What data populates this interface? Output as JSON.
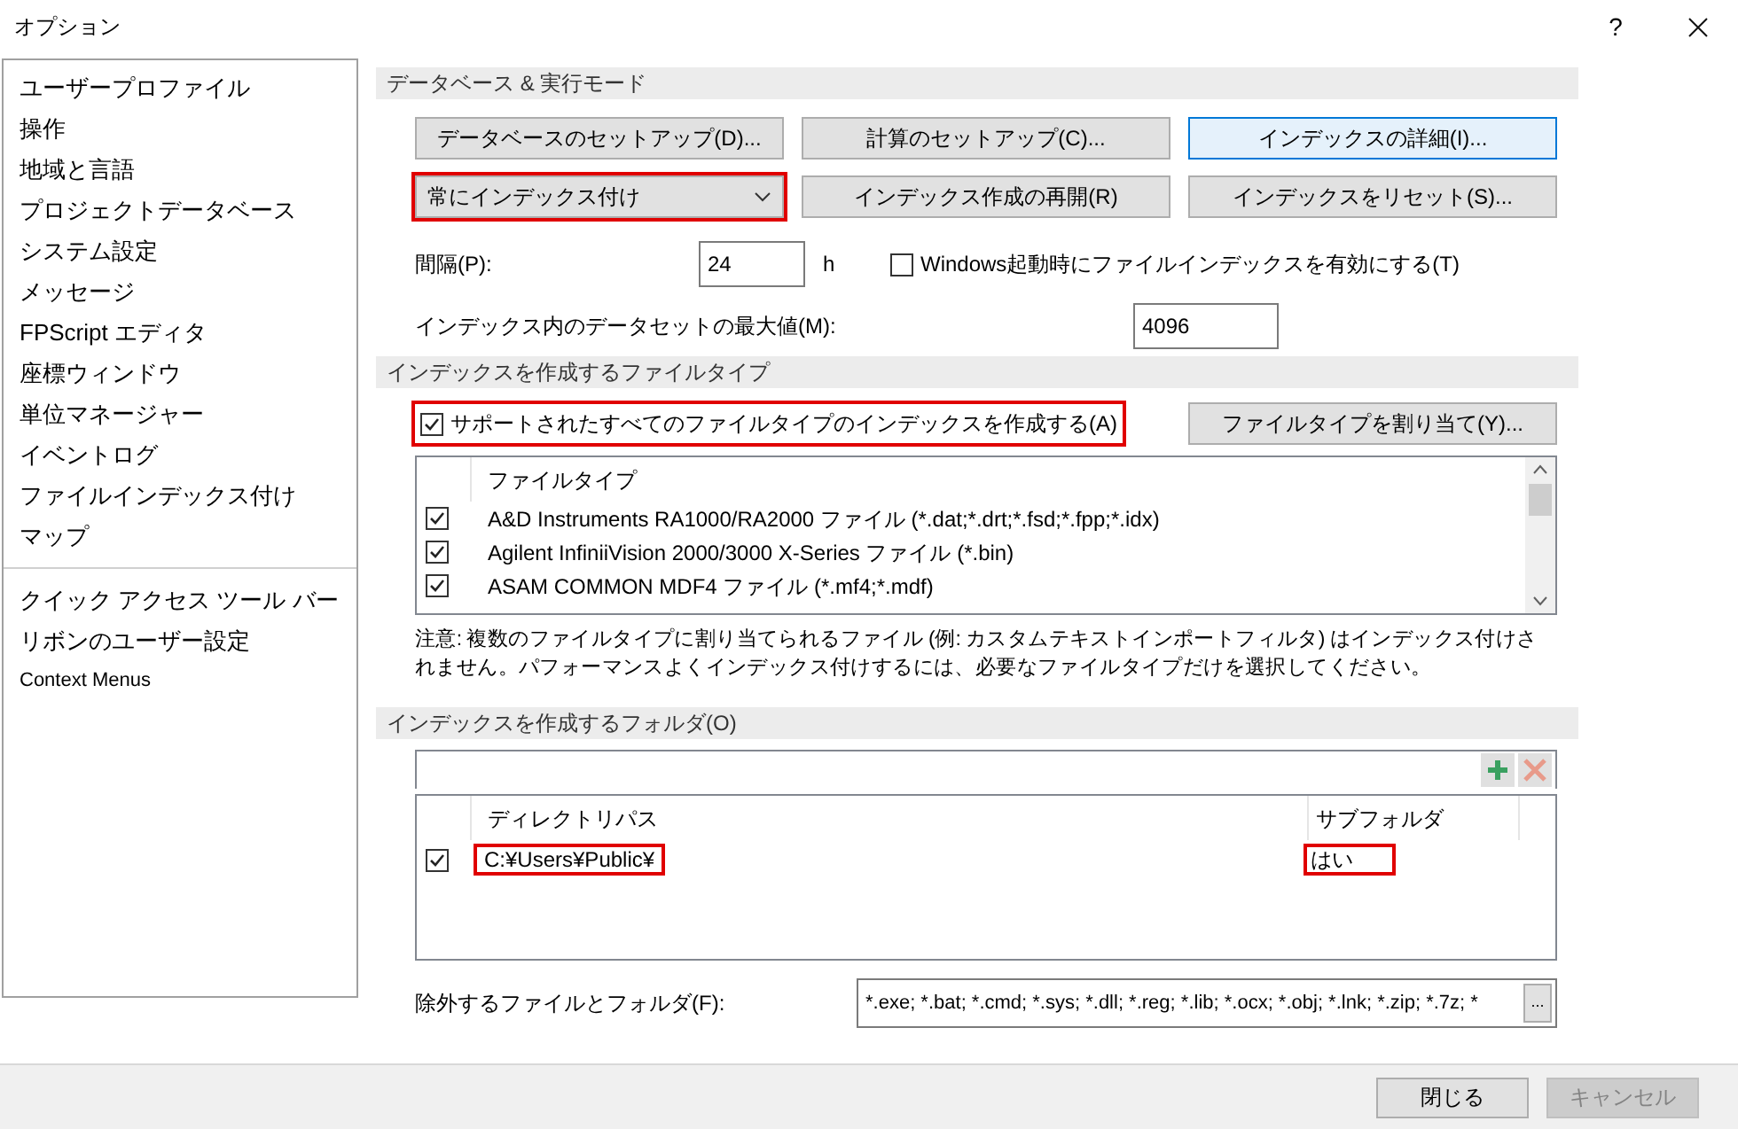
{
  "window": {
    "title": "オプション",
    "help": "?"
  },
  "sidebar": {
    "groups": [
      [
        {
          "label": "ユーザープロファイル",
          "selected": false
        },
        {
          "label": "操作",
          "selected": false
        },
        {
          "label": "地域と言語",
          "selected": false
        },
        {
          "label": "プロジェクトデータベース",
          "selected": false
        },
        {
          "label": "システム設定",
          "selected": false
        },
        {
          "label": "メッセージ",
          "selected": false
        },
        {
          "label": "FPScript エディタ",
          "selected": false
        },
        {
          "label": "座標ウィンドウ",
          "selected": false
        },
        {
          "label": "単位マネージャー",
          "selected": false
        },
        {
          "label": "イベントログ",
          "selected": false
        },
        {
          "label": "ファイルインデックス付け",
          "selected": false
        },
        {
          "label": "マップ",
          "selected": false
        }
      ],
      [
        {
          "label": "クイック アクセス ツール バー",
          "selected": false
        },
        {
          "label": "リボンのユーザー設定",
          "selected": false
        },
        {
          "label": "Context Menus",
          "selected": false
        }
      ]
    ]
  },
  "database_section": {
    "title": "データベース & 実行モード",
    "buttons": [
      {
        "label": "データベースのセットアップ(D)...",
        "focused": false
      },
      {
        "label": "計算のセットアップ(C)...",
        "focused": false
      },
      {
        "label": "インデックスの詳細(I)...",
        "focused": true
      }
    ],
    "mode_dropdown": {
      "value": "常にインデックス付け",
      "highlighted": true
    },
    "buttons_2": [
      {
        "label": "インデックス作成の再開(R)",
        "focused": false
      },
      {
        "label": "インデックスをリセット(S)...",
        "focused": false
      }
    ],
    "interval": {
      "label": "間隔(P):",
      "value": "24",
      "unit": "h"
    },
    "startup_checkbox": {
      "label": "Windows起動時にファイルインデックスを有効にする(T)",
      "checked": false
    },
    "max_datasets": {
      "label": "インデックス内のデータセットの最大値(M):",
      "value": "4096"
    }
  },
  "file_types_section": {
    "title": "インデックスを作成するファイルタイプ",
    "all_checkbox": {
      "label": "サポートされたすべてのファイルタイプのインデックスを作成する(A)",
      "checked": true,
      "highlighted": true
    },
    "assign_button": "ファイルタイプを割り当て(Y)...",
    "column": "ファイルタイプ",
    "rows": [
      {
        "label": "A&D Instruments RA1000/RA2000 ファイル (*.dat;*.drt;*.fsd;*.fpp;*.idx)",
        "checked": true
      },
      {
        "label": "Agilent InfiniiVision 2000/3000 X-Series ファイル (*.bin)",
        "checked": true
      },
      {
        "label": "ASAM COMMON MDF4 ファイル (*.mf4;*.mdf)",
        "checked": true
      }
    ],
    "note": "注意: 複数のファイルタイプに割り当てられるファイル (例: カスタムテキストインポートフィルタ) はインデックス付けされません。パフォーマンスよくインデックス付けするには、必要なファイルタイプだけを選択してください。"
  },
  "folders_section": {
    "title": "インデックスを作成するフォルダ(O)",
    "columns": [
      "ディレクトリパス",
      "サブフォルダ"
    ],
    "rows": [
      {
        "checked": true,
        "path": "C:¥Users¥Public¥",
        "subfolders": "はい",
        "highlighted": true
      }
    ],
    "exclude": {
      "label": "除外するファイルとフォルダ(F):",
      "value": "*.exe; *.bat; *.cmd; *.sys; *.dll; *.reg; *.lib; *.ocx; *.obj; *.lnk; *.zip; *.7z; *",
      "browse": "..."
    }
  },
  "footer": {
    "buttons": [
      {
        "label": "閉じる",
        "disabled": false
      },
      {
        "label": "キャンセル",
        "disabled": true
      }
    ]
  }
}
